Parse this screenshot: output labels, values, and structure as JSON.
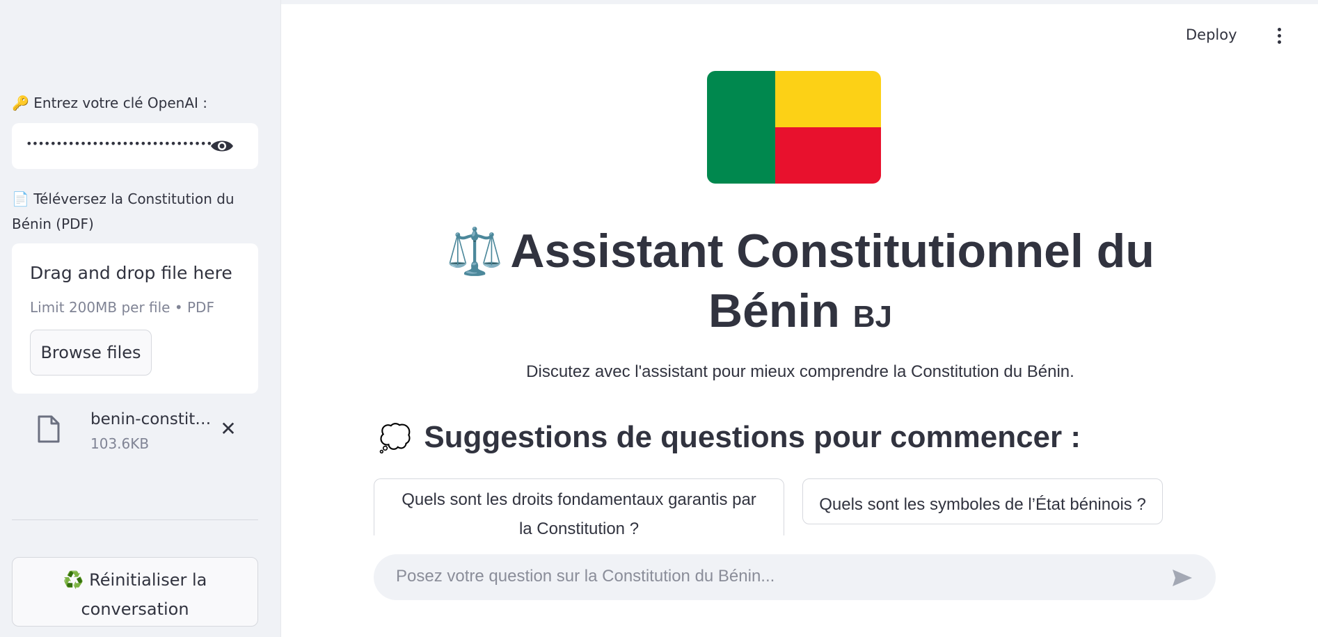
{
  "sidebar": {
    "key_label_icon": "key-icon",
    "key_label": "🔑 Entrez votre clé OpenAI :",
    "key_value": "•••••••••••••••••••••••••••••••",
    "upload_label_line1": "📄 Téléversez la Constitution du",
    "upload_label_line2": "Bénin (PDF)",
    "dropzone_title": "Drag and drop file here",
    "dropzone_limit": "Limit 200MB per file • PDF",
    "browse_label": "Browse files",
    "file_name": "benin-constit…",
    "file_size": "103.6KB",
    "reset_line1": "♻️ Réinitialiser la",
    "reset_line2": "conversation"
  },
  "header": {
    "deploy_label": "Deploy"
  },
  "main": {
    "flag_colors": {
      "green": "#00884e",
      "yellow": "#fcd116",
      "red": "#e8112d"
    },
    "title_emoji": "⚖️",
    "title_line1": "Assistant Constitutionnel du",
    "title_line2": "Bénin",
    "title_suffix": "BJ",
    "subtitle": "Discutez avec l'assistant pour mieux comprendre la Constitution du Bénin.",
    "suggest_emoji": "💭",
    "suggest_title": "Suggestions de questions pour commencer :",
    "suggestions": [
      {
        "line1": "Quels sont les droits fondamentaux garantis par",
        "line2": "la Constitution ?"
      },
      {
        "line1": "Quels sont les symboles de l’État béninois ?"
      }
    ],
    "chat_placeholder": "Posez votre question sur la Constitution du Bénin..."
  }
}
